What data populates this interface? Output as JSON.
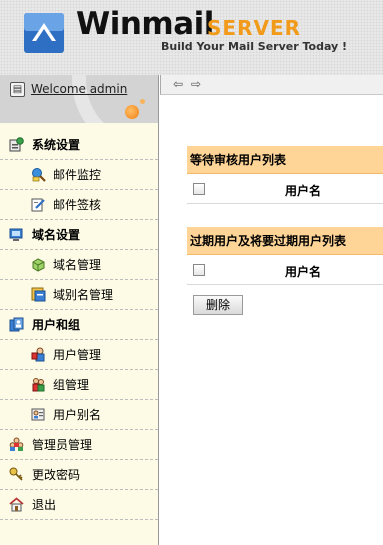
{
  "header": {
    "brand": "Winmail",
    "product": "SERVER",
    "tagline": "Build Your Mail Server Today !"
  },
  "sidebar": {
    "welcome": "Welcome admin",
    "items": [
      {
        "label": "系统设置",
        "icon": "settings-icon",
        "level": "group"
      },
      {
        "label": "邮件监控",
        "icon": "mail-monitor-icon",
        "level": "sub"
      },
      {
        "label": "邮件签核",
        "icon": "mail-approve-icon",
        "level": "sub"
      },
      {
        "label": "域名设置",
        "icon": "domain-settings-icon",
        "level": "group"
      },
      {
        "label": "域名管理",
        "icon": "domain-manage-icon",
        "level": "sub"
      },
      {
        "label": "域别名管理",
        "icon": "domain-alias-icon",
        "level": "sub"
      },
      {
        "label": "用户和组",
        "icon": "users-groups-icon",
        "level": "group"
      },
      {
        "label": "用户管理",
        "icon": "user-manage-icon",
        "level": "sub"
      },
      {
        "label": "组管理",
        "icon": "group-manage-icon",
        "level": "sub"
      },
      {
        "label": "用户别名",
        "icon": "user-alias-icon",
        "level": "sub"
      },
      {
        "label": "管理员管理",
        "icon": "admin-manage-icon",
        "level": "group-plain"
      },
      {
        "label": "更改密码",
        "icon": "key-icon",
        "level": "group-plain"
      },
      {
        "label": "退出",
        "icon": "home-icon",
        "level": "group-plain"
      }
    ]
  },
  "toolbar": {
    "back": "⇦",
    "forward": "⇨"
  },
  "main": {
    "pending_title": "等待审核用户列表",
    "pending_column": "用户名",
    "expired_title": "过期用户及将要过期用户列表",
    "expired_column": "用户名",
    "delete_label": "删除"
  },
  "colors": {
    "accent_orange": "#f29a1a",
    "section_header": "#fed597",
    "sidebar_bg": "#fdfbe6"
  }
}
